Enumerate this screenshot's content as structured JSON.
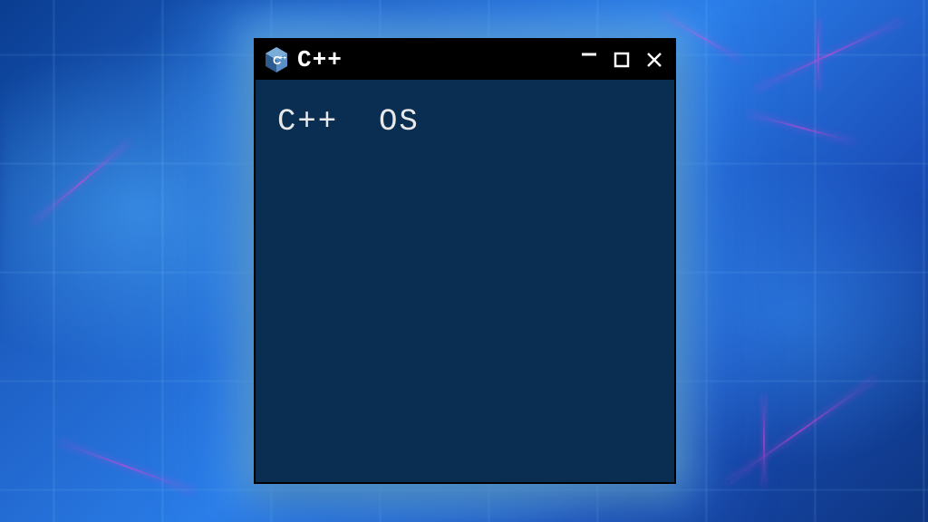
{
  "window": {
    "title": "C++",
    "body_text": "C++  OS"
  },
  "colors": {
    "window_bg": "#0a2d52",
    "titlebar_bg": "#000000",
    "text": "#e8e8e8",
    "icon_blue": "#5a8fc7",
    "icon_dark": "#2d5a8f"
  }
}
